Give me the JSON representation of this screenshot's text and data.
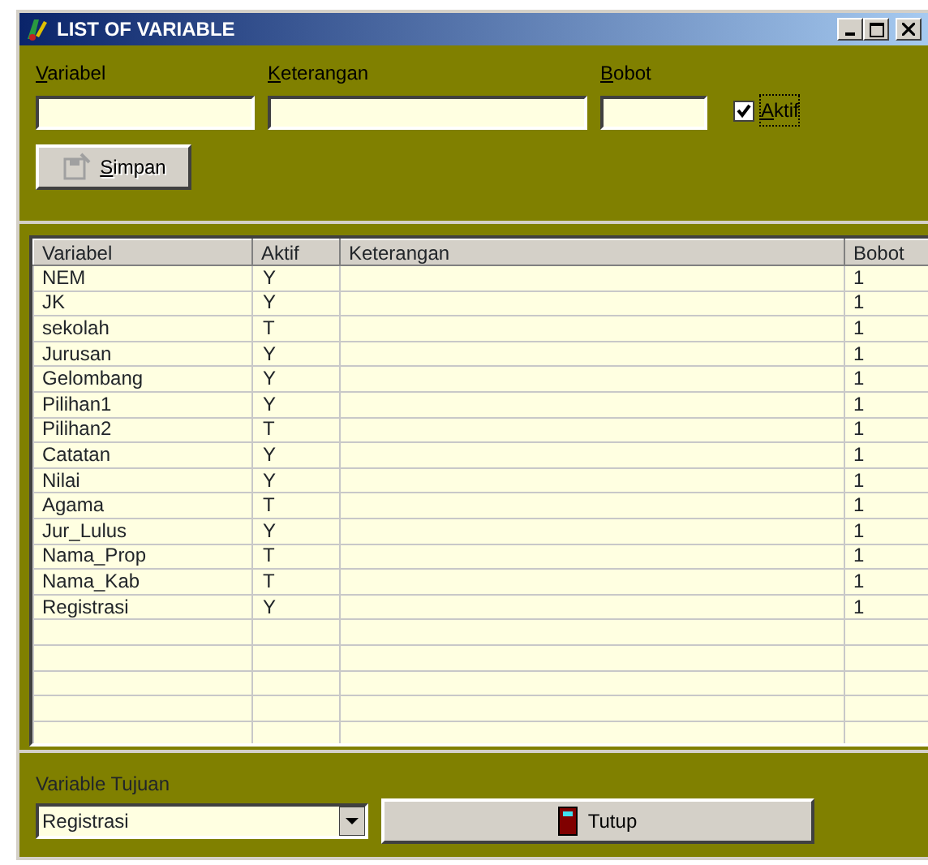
{
  "window": {
    "title": "LIST OF VARIABLE"
  },
  "form": {
    "fields": [
      {
        "label": "Variabel"
      },
      {
        "label": "Keterangan"
      },
      {
        "label": "Bobot"
      }
    ],
    "aktif": {
      "label": "Aktif",
      "checked": true
    },
    "save_button": {
      "label": "Simpan",
      "disabled": true
    }
  },
  "table": {
    "columns": [
      "Variabel",
      "Aktif",
      "Keterangan",
      "Bobot"
    ],
    "rows": [
      {
        "variabel": "NEM",
        "aktif": "Y",
        "bobot": "1"
      },
      {
        "variabel": "JK",
        "aktif": "Y",
        "bobot": "1"
      },
      {
        "variabel": "sekolah",
        "aktif": "T",
        "bobot": "1"
      },
      {
        "variabel": "Jurusan",
        "aktif": "Y",
        "bobot": "1"
      },
      {
        "variabel": "Gelombang",
        "aktif": "Y",
        "bobot": "1"
      },
      {
        "variabel": "Pilihan1",
        "aktif": "Y",
        "bobot": "1"
      },
      {
        "variabel": "Pilihan2",
        "aktif": "T",
        "bobot": "1"
      },
      {
        "variabel": "Catatan",
        "aktif": "Y",
        "bobot": "1"
      },
      {
        "variabel": "Nilai",
        "aktif": "Y",
        "bobot": "1"
      },
      {
        "variabel": "Agama",
        "aktif": "T",
        "bobot": "1"
      },
      {
        "variabel": "Jur_Lulus",
        "aktif": "Y",
        "bobot": "1"
      },
      {
        "variabel": "Nama_Prop",
        "aktif": "T",
        "bobot": "1"
      },
      {
        "variabel": "Nama_Kab",
        "aktif": "T",
        "bobot": "1"
      },
      {
        "variabel": "Registrasi",
        "aktif": "Y",
        "bobot": "1"
      }
    ]
  },
  "bottom": {
    "target_label": "Variable Tujuan",
    "target_value": "Registrasi",
    "close_button": "Tutup"
  }
}
